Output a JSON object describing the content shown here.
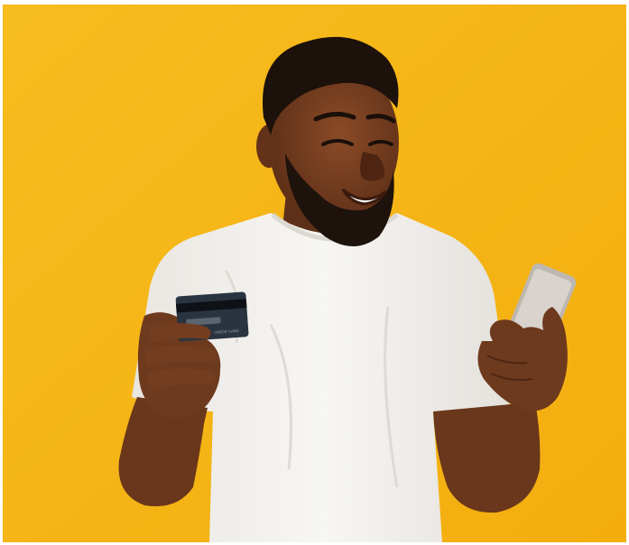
{
  "photo": {
    "background_color": "#F5B512",
    "skin_color": "#6E3A1E",
    "shirt_color": "#F4F2EE",
    "hair_color": "#1C110B",
    "card": {
      "color": "#2A3440",
      "stripe_color": "#0E1217",
      "text": "CREDIT CARD"
    },
    "phone": {
      "color": "#BDB7B0",
      "screen_color": "#D8D3CD"
    }
  }
}
